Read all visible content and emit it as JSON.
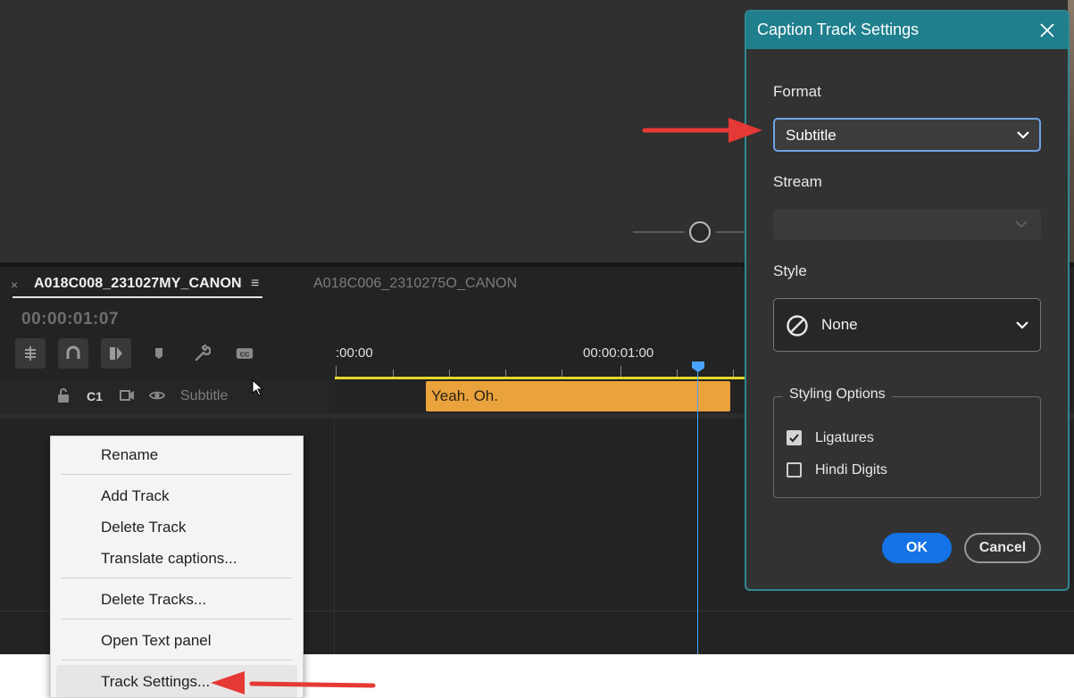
{
  "timeline": {
    "tab_close": "×",
    "active_sequence": "A018C008_231027MY_CANON",
    "menu_icon": "≡",
    "inactive_sequence": "A018C006_2310275O_CANON",
    "timecode": "00:00:01:07",
    "ruler": {
      "start_label": ":00:00",
      "mid_label": "00:00:01:00"
    },
    "track": {
      "name": "C1",
      "format_label": "Subtitle"
    },
    "clip_text": "Yeah. Oh."
  },
  "context_menu": {
    "items": [
      "Rename",
      "Add Track",
      "Delete Track",
      "Translate captions...",
      "Delete Tracks...",
      "Open Text panel",
      "Track Settings..."
    ]
  },
  "dialog": {
    "title": "Caption Track Settings",
    "format_label": "Format",
    "format_value": "Subtitle",
    "stream_label": "Stream",
    "stream_value": "",
    "style_label": "Style",
    "style_value": "None",
    "styling_options_label": "Styling Options",
    "ligatures_label": "Ligatures",
    "ligatures_checked": true,
    "hindi_digits_label": "Hindi Digits",
    "hindi_digits_checked": false,
    "ok_label": "OK",
    "cancel_label": "Cancel"
  },
  "colors": {
    "accent_blue": "#1473e6",
    "dialog_titlebar": "#1f7f8c",
    "clip_orange": "#e9a23c",
    "arrow_red": "#e53935",
    "playhead_blue": "#4aa3ff"
  },
  "icons": [
    "ripple-edit-icon",
    "snap-magnet-icon",
    "linked-selection-icon",
    "marker-icon",
    "wrench-icon",
    "closed-captions-icon",
    "lock-icon",
    "toggle-track-output-icon",
    "eye-icon",
    "close-icon",
    "chevron-down-icon",
    "none-circle-slash-icon",
    "checkmark-icon",
    "red-arrow-icon"
  ]
}
